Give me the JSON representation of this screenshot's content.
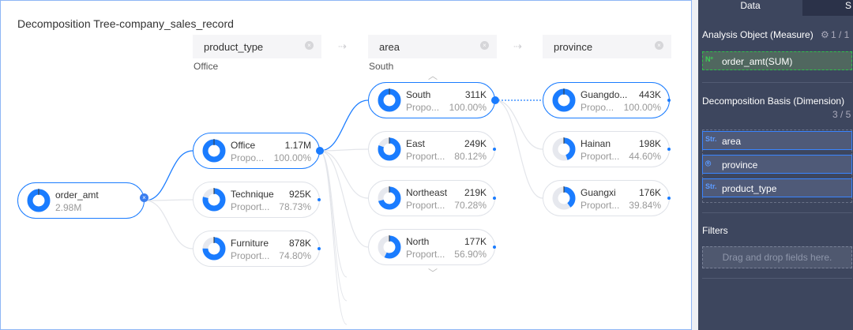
{
  "title": "Decomposition Tree-company_sales_record",
  "headers": [
    {
      "label": "product_type",
      "selected": "Office"
    },
    {
      "label": "area",
      "selected": "South"
    },
    {
      "label": "province",
      "selected": ""
    }
  ],
  "root": {
    "name": "order_amt",
    "value": "2.98M",
    "proportion": 1
  },
  "columns": [
    [
      {
        "name": "Office",
        "value": "1.17M",
        "prop_label": "Propo...",
        "prop": "100.00%",
        "ratio": 1,
        "active": true
      },
      {
        "name": "Technique",
        "value": "925K",
        "prop_label": "Proport...",
        "prop": "78.73%",
        "ratio": 0.7873
      },
      {
        "name": "Furniture",
        "value": "878K",
        "prop_label": "Proport...",
        "prop": "74.80%",
        "ratio": 0.748
      }
    ],
    [
      {
        "name": "South",
        "value": "311K",
        "prop_label": "Propo...",
        "prop": "100.00%",
        "ratio": 1,
        "active": true
      },
      {
        "name": "East",
        "value": "249K",
        "prop_label": "Proport...",
        "prop": "80.12%",
        "ratio": 0.8012
      },
      {
        "name": "Northeast",
        "value": "219K",
        "prop_label": "Proport...",
        "prop": "70.28%",
        "ratio": 0.7028
      },
      {
        "name": "North",
        "value": "177K",
        "prop_label": "Proport...",
        "prop": "56.90%",
        "ratio": 0.569
      }
    ],
    [
      {
        "name": "Guangdo...",
        "value": "443K",
        "prop_label": "Propo...",
        "prop": "100.00%",
        "ratio": 1,
        "active": true
      },
      {
        "name": "Hainan",
        "value": "198K",
        "prop_label": "Proport...",
        "prop": "44.60%",
        "ratio": 0.446
      },
      {
        "name": "Guangxi",
        "value": "176K",
        "prop_label": "Proport...",
        "prop": "39.84%",
        "ratio": 0.3984
      }
    ]
  ],
  "sidebar": {
    "tabs": [
      "Data",
      "S"
    ],
    "measure_title": "Analysis Object (Measure)",
    "measure_count": "1 / 1",
    "measure_field": {
      "icon": "Nº",
      "label": "order_amt(SUM)"
    },
    "dim_title": "Decomposition Basis (Dimension)",
    "dim_count": "3 / 5",
    "dims": [
      {
        "icon": "Str.",
        "label": "area"
      },
      {
        "icon": "pin",
        "label": "province"
      },
      {
        "icon": "Str.",
        "label": "product_type"
      }
    ],
    "filters_title": "Filters",
    "filters_placeholder": "Drag and drop fields here."
  },
  "colors": {
    "accent": "#1a7cff",
    "sidebar": "#3d465e"
  }
}
